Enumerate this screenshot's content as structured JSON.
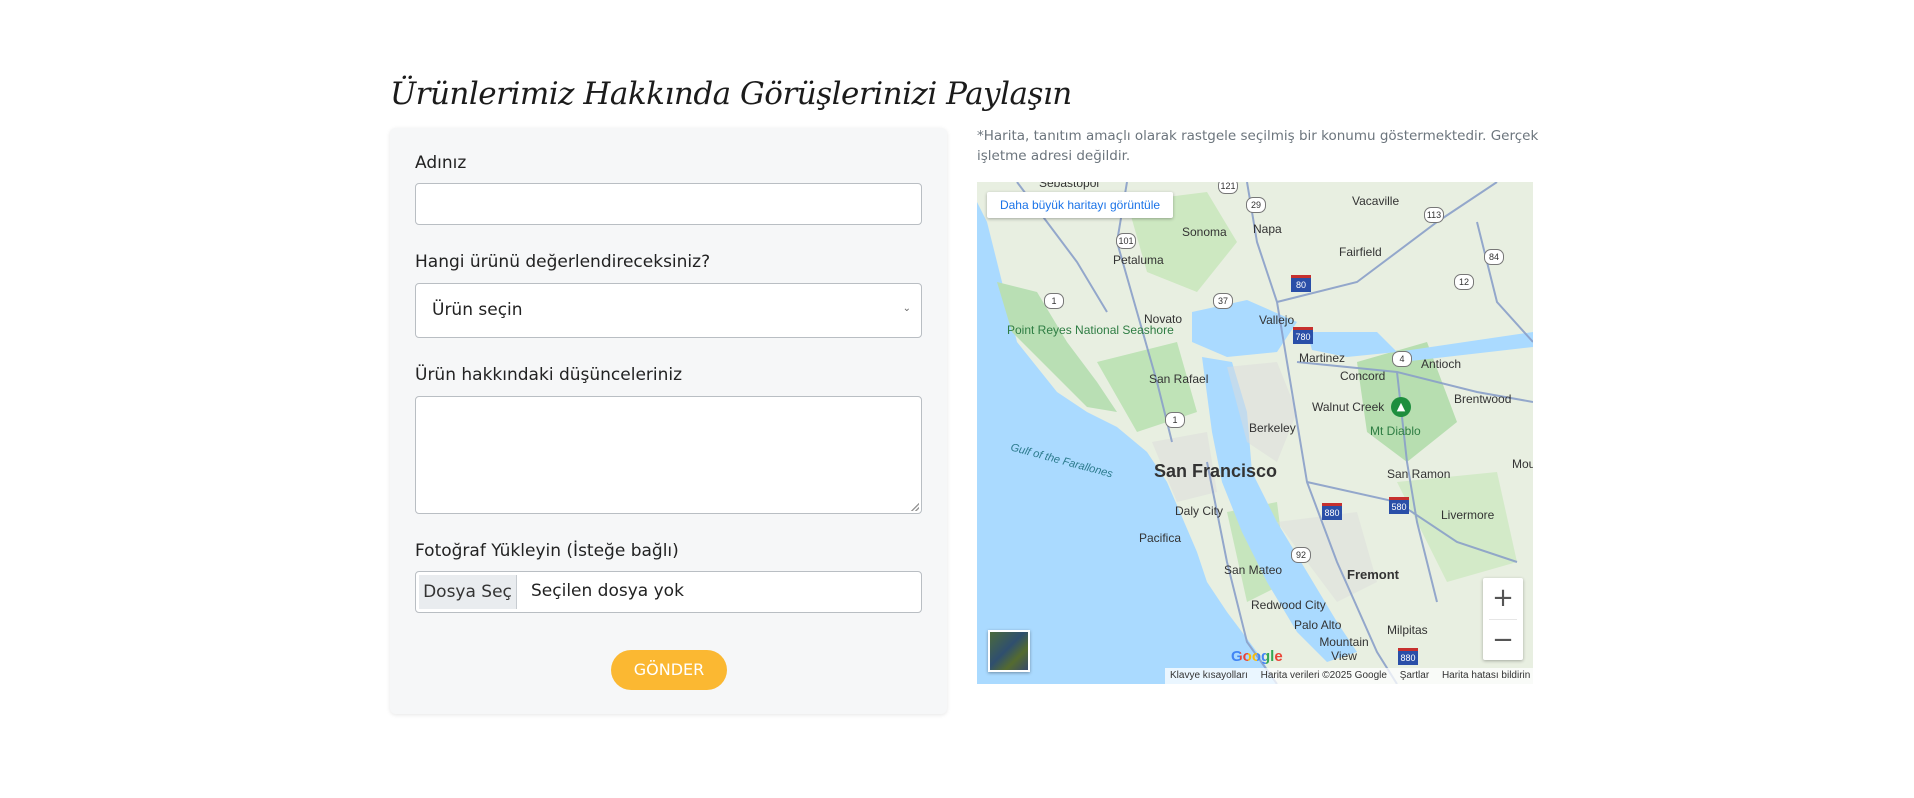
{
  "page": {
    "title": "Ürünlerimiz Hakkında Görüşlerinizi Paylaşın"
  },
  "form": {
    "name_label": "Adınız",
    "name_value": "",
    "product_label": "Hangi ürünü değerlendireceksiniz?",
    "product_selected": "Ürün seçin",
    "thoughts_label": "Ürün hakkındaki düşünceleriniz",
    "thoughts_value": "",
    "photo_label": "Fotoğraf Yükleyin (İsteğe bağlı)",
    "file_button": "Dosya Seç",
    "file_status": "Seçilen dosya yok",
    "submit": "GÖNDER"
  },
  "map": {
    "note": "*Harita, tanıtım amaçlı olarak rastgele seçilmiş bir konumu göstermektedir. Gerçek işletme adresi değildir.",
    "larger_map": "Daha büyük haritayı görüntüle",
    "zoom_in": "+",
    "zoom_out": "−",
    "google": "Google",
    "attr_shortcuts": "Klavye kısayolları",
    "attr_data": "Harita verileri ©2025 Google",
    "attr_terms": "Şartlar",
    "attr_report": "Harita hatası bildirin",
    "places": {
      "sebastopol": "Sebastopol",
      "vacaville": "Vacaville",
      "sonoma": "Sonoma",
      "napa": "Napa",
      "fairfield": "Fairfield",
      "petaluma": "Petaluma",
      "novato": "Novato",
      "vallejo": "Vallejo",
      "point_reyes": "Point Reyes National Seashore",
      "martinez": "Martinez",
      "antioch": "Antioch",
      "concord": "Concord",
      "san_rafael": "San Rafael",
      "walnut_creek": "Walnut Creek",
      "brentwood": "Brentwood",
      "mt_diablo": "Mt Diablo",
      "berkeley": "Berkeley",
      "gulf": "Gulf of the Farallones",
      "san_francisco": "San Francisco",
      "san_ramon": "San Ramon",
      "mou": "Mou",
      "daly_city": "Daly City",
      "pacifica": "Pacifica",
      "livermore": "Livermore",
      "san_mateo": "San Mateo",
      "fremont": "Fremont",
      "redwood_city": "Redwood City",
      "palo_alto": "Palo Alto",
      "mountain_view": "Mountain View",
      "milpitas": "Milpitas"
    },
    "shields": {
      "s121": "121",
      "s29": "29",
      "s113": "113",
      "s101": "101",
      "s84": "84",
      "s12": "12",
      "s37": "37",
      "s80": "80",
      "s1a": "1",
      "s780": "780",
      "s4": "4",
      "s1b": "1",
      "s880a": "880",
      "s580": "580",
      "s92": "92",
      "s880b": "880"
    }
  }
}
